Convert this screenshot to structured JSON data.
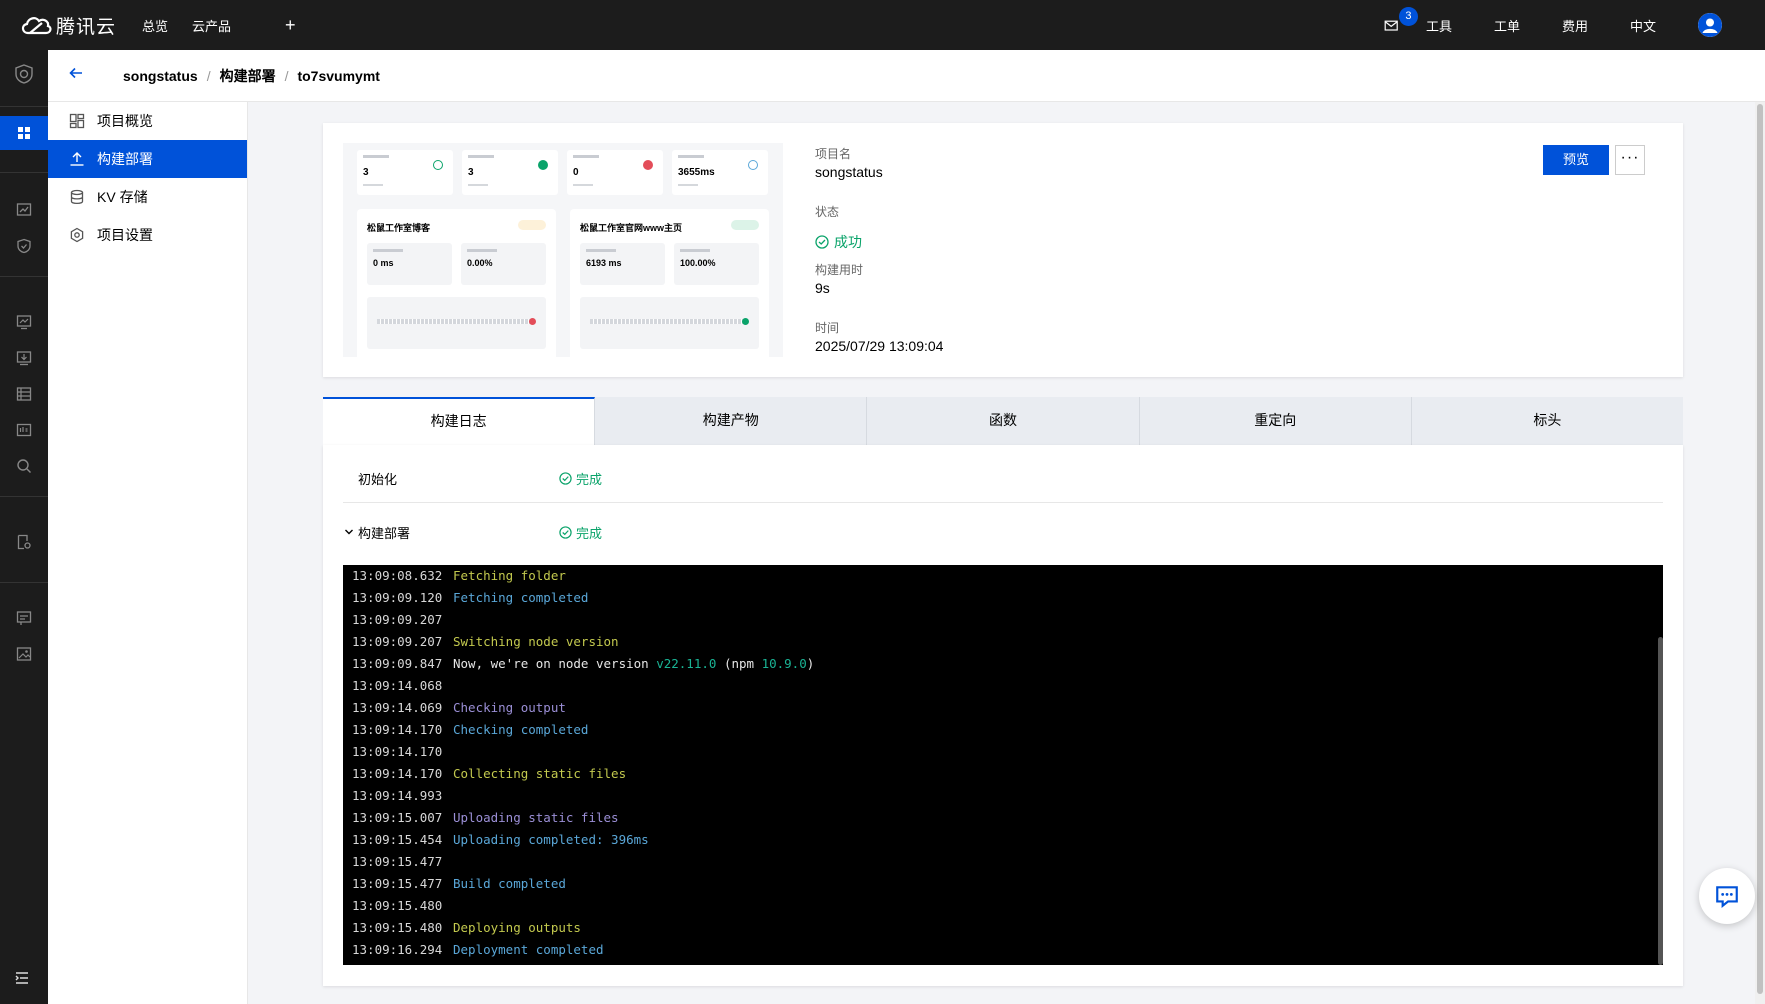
{
  "brand": {
    "name": "腾讯云"
  },
  "topnav": {
    "overview": "总览",
    "products": "云产品",
    "add": "+"
  },
  "topright": {
    "mail_count": "3",
    "tools": "工具",
    "tickets": "工单",
    "billing": "费用",
    "language": "中文"
  },
  "breadcrumb": {
    "project": "songstatus",
    "section": "构建部署",
    "deployment": "to7svumymt",
    "separator": "/"
  },
  "side_menu": {
    "items": [
      {
        "label": "项目概览",
        "icon": "dashboard-icon"
      },
      {
        "label": "构建部署",
        "icon": "upload-icon"
      },
      {
        "label": "KV 存储",
        "icon": "database-icon"
      },
      {
        "label": "项目设置",
        "icon": "settings-icon"
      }
    ],
    "active_index": 1
  },
  "info": {
    "project_label": "项目名",
    "project_value": "songstatus",
    "status_label": "状态",
    "status_value": "成功",
    "duration_label": "构建用时",
    "duration_value": "9s",
    "time_label": "时间",
    "time_value": "2025/07/29 13:09:04",
    "preview_button": "预览",
    "more_button": "···"
  },
  "preview_thumbnail": {
    "stats": [
      "3",
      "3",
      "0",
      "3655ms"
    ],
    "panels": [
      {
        "title": "松鼠工作室博客",
        "metrics": [
          "0 ms",
          "0.00%"
        ]
      },
      {
        "title": "松鼠工作室官网www主页",
        "metrics": [
          "6193 ms",
          "100.00%"
        ]
      }
    ]
  },
  "tabs": [
    "构建日志",
    "构建产物",
    "函数",
    "重定向",
    "标头"
  ],
  "active_tab": 0,
  "steps": [
    {
      "name": "初始化",
      "status": "完成"
    },
    {
      "name": "构建部署",
      "status": "完成",
      "toggle": "⌄"
    }
  ],
  "log": [
    {
      "ts": "13:09:08.632",
      "msg": "Fetching folder",
      "color": "yellow"
    },
    {
      "ts": "13:09:09.120",
      "msg": "Fetching completed",
      "color": "blue"
    },
    {
      "ts": "13:09:09.207",
      "msg": "",
      "color": "white"
    },
    {
      "ts": "13:09:09.207",
      "msg": "Switching node version",
      "color": "yellow"
    },
    {
      "ts": "13:09:09.847",
      "msg": "node_version",
      "color": "white"
    },
    {
      "ts": "13:09:14.068",
      "msg": "",
      "color": "white"
    },
    {
      "ts": "13:09:14.069",
      "msg": "Checking output",
      "color": "purple"
    },
    {
      "ts": "13:09:14.170",
      "msg": "Checking completed",
      "color": "blue"
    },
    {
      "ts": "13:09:14.170",
      "msg": "",
      "color": "white"
    },
    {
      "ts": "13:09:14.170",
      "msg": "Collecting static files",
      "color": "yellow"
    },
    {
      "ts": "13:09:14.993",
      "msg": "",
      "color": "white"
    },
    {
      "ts": "13:09:15.007",
      "msg": "Uploading static files",
      "color": "purple"
    },
    {
      "ts": "13:09:15.454",
      "msg": "Uploading completed: 396ms",
      "color": "blue"
    },
    {
      "ts": "13:09:15.477",
      "msg": "",
      "color": "white"
    },
    {
      "ts": "13:09:15.477",
      "msg": "Build completed",
      "color": "blue"
    },
    {
      "ts": "13:09:15.480",
      "msg": "",
      "color": "white"
    },
    {
      "ts": "13:09:15.480",
      "msg": "Deploying outputs",
      "color": "yellow"
    },
    {
      "ts": "13:09:16.294",
      "msg": "Deployment completed",
      "color": "blue"
    }
  ],
  "node_version_line": {
    "prefix": "Now, we're on node version ",
    "node": "v22.11.0",
    "mid": " (npm ",
    "npm": "10.9.0",
    "suffix": ")"
  },
  "colors": {
    "accent": "#0052d9",
    "success": "#0aa36a"
  }
}
